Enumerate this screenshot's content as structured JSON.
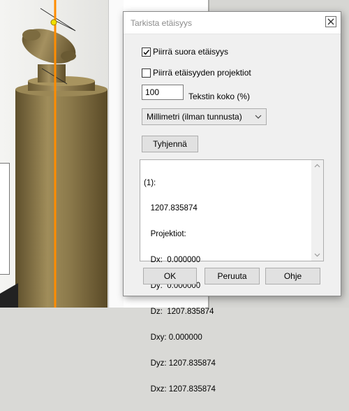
{
  "dialog": {
    "title": "Tarkista etäisyys",
    "draw_direct": {
      "label": "Piirrä suora etäisyys",
      "checked": true
    },
    "draw_projection": {
      "label": "Piirrä etäisyyden projektiot",
      "checked": false
    },
    "text_size": {
      "value": "100",
      "label": "Tekstin koko (%)"
    },
    "unit_select": {
      "value": "Millimetri (ilman tunnusta)"
    },
    "clear_button": "Tyhjennä",
    "results": [
      "(1):",
      "   1207.835874",
      "   Projektiot:",
      "   Dx:  0.000000",
      "   Dy:  0.000000",
      "   Dz:  1207.835874",
      "   Dxy: 0.000000",
      "   Dyz: 1207.835874",
      "   Dxz: 1207.835874"
    ],
    "ok_button": "OK",
    "cancel_button": "Peruuta",
    "help_button": "Ohje"
  },
  "colors": {
    "measure_line": "#ff8c00",
    "column_wood": "#8b7a4e",
    "dialog_bg": "#f0f0f0"
  },
  "icons": [
    "close-icon",
    "check-icon",
    "chevron-down-icon",
    "scroll-up-icon",
    "scroll-down-icon"
  ]
}
